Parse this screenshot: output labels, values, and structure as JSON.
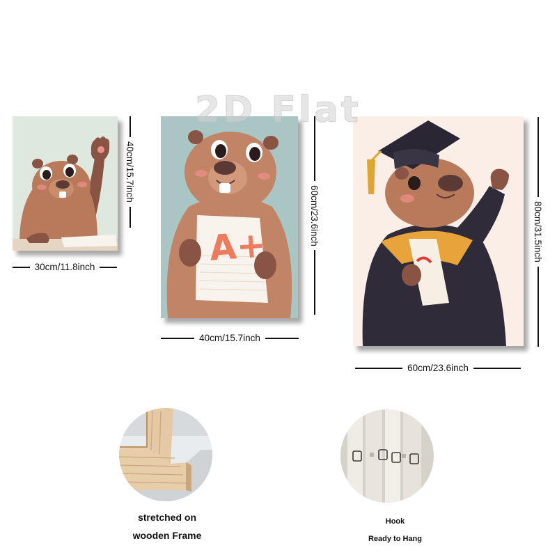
{
  "watermark": "2D Flat",
  "paintings": [
    {
      "width_label": "30cm/11.8inch",
      "height_label": "40cm/15.7inch"
    },
    {
      "width_label": "40cm/15.7inch",
      "height_label": "60cm/23.6inch",
      "grade_text": "A+"
    },
    {
      "width_label": "60cm/23.6inch",
      "height_label": "80cm/31.5inch"
    }
  ],
  "features": [
    {
      "line1": "stretched on",
      "line2": "wooden Frame"
    },
    {
      "line1": "Hook",
      "line2": "Ready to Hang"
    }
  ],
  "colors": {
    "fur": "#b97a5c",
    "fur_dark": "#8a5444",
    "nose": "#5b3a36",
    "cheek": "#ef8f8a",
    "bg_small": "#d9e6dc",
    "bg_medium": "#a9c6c4",
    "bg_large": "#faeee6",
    "gown": "#2f2b38",
    "tassel": "#e0a431",
    "grade": "#ef7b5f",
    "wood": "#e5c9a4"
  }
}
